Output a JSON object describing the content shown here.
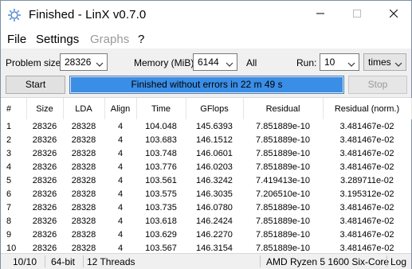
{
  "window": {
    "title": "Finished - LinX v0.7.0"
  },
  "menu": [
    {
      "label": "File",
      "disabled": false
    },
    {
      "label": "Settings",
      "disabled": false
    },
    {
      "label": "Graphs",
      "disabled": true
    },
    {
      "label": "?",
      "disabled": false
    }
  ],
  "controls": {
    "problem_size_label": "Problem size:",
    "problem_size_value": "28326",
    "memory_label": "Memory (MiB):",
    "memory_value": "6144",
    "memory_option": "All",
    "run_label": "Run:",
    "run_value": "10",
    "run_unit": "times",
    "start_label": "Start",
    "stop_label": "Stop",
    "progress_text": "Finished without errors in 22 m 49 s",
    "progress_fraction": 1.0
  },
  "table": {
    "columns": [
      "#",
      "Size",
      "LDA",
      "Align",
      "Time",
      "GFlops",
      "Residual",
      "Residual (norm.)"
    ],
    "rows": [
      [
        "1",
        "28326",
        "28328",
        "4",
        "104.048",
        "145.6393",
        "7.851889e-10",
        "3.481467e-02"
      ],
      [
        "2",
        "28326",
        "28328",
        "4",
        "103.683",
        "146.1512",
        "7.851889e-10",
        "3.481467e-02"
      ],
      [
        "3",
        "28326",
        "28328",
        "4",
        "103.748",
        "146.0601",
        "7.851889e-10",
        "3.481467e-02"
      ],
      [
        "4",
        "28326",
        "28328",
        "4",
        "103.776",
        "146.0203",
        "7.851889e-10",
        "3.481467e-02"
      ],
      [
        "5",
        "28326",
        "28328",
        "4",
        "103.561",
        "146.3242",
        "7.419413e-10",
        "3.289711e-02"
      ],
      [
        "6",
        "28326",
        "28328",
        "4",
        "103.575",
        "146.3035",
        "7.206510e-10",
        "3.195312e-02"
      ],
      [
        "7",
        "28326",
        "28328",
        "4",
        "103.735",
        "146.0780",
        "7.851889e-10",
        "3.481467e-02"
      ],
      [
        "8",
        "28326",
        "28328",
        "4",
        "103.618",
        "146.2424",
        "7.851889e-10",
        "3.481467e-02"
      ],
      [
        "9",
        "28326",
        "28328",
        "4",
        "103.629",
        "146.2270",
        "7.851889e-10",
        "3.481467e-02"
      ],
      [
        "10",
        "28326",
        "28328",
        "4",
        "103.567",
        "146.3154",
        "7.851889e-10",
        "3.481467e-02"
      ]
    ]
  },
  "status": {
    "progress": "10/10",
    "arch": "64-bit",
    "threads": "12 Threads",
    "cpu": "AMD Ryzen 5 1600 Six-Core",
    "log": "Log"
  },
  "colors": {
    "progress_fill": "#3a8ee6",
    "progress_border": "#4a7fbf"
  },
  "icons": [
    "app-gear-icon",
    "minimize-icon",
    "maximize-icon",
    "close-icon",
    "chevron-down-icon",
    "chevron-right-icon"
  ]
}
